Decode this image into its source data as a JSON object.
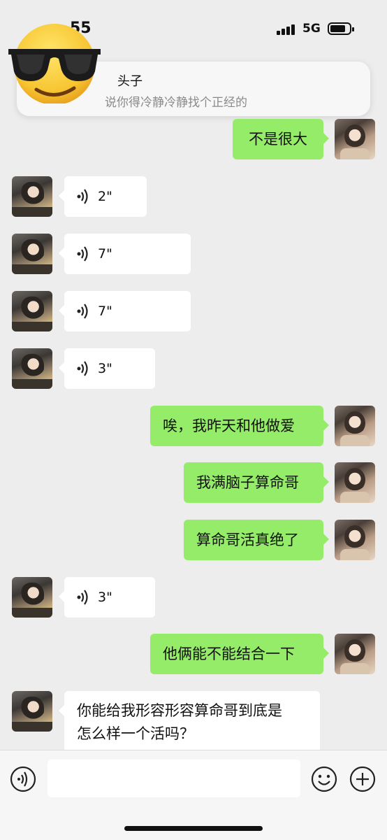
{
  "status_bar": {
    "time": "55",
    "network": "5G",
    "battery_level": 0.8
  },
  "notification": {
    "sender": "头子",
    "preview": "说你得冷静冷静找个正经的"
  },
  "messages": [
    {
      "side": "out",
      "type": "text",
      "text": "不是很大"
    },
    {
      "side": "in",
      "type": "voice",
      "duration": "2\""
    },
    {
      "side": "in",
      "type": "voice",
      "duration": "7\""
    },
    {
      "side": "in",
      "type": "voice",
      "duration": "7\""
    },
    {
      "side": "in",
      "type": "voice",
      "duration": "3\""
    },
    {
      "side": "out",
      "type": "text",
      "text": "唉，我昨天和他做爱"
    },
    {
      "side": "out",
      "type": "text",
      "text": "我满脑子算命哥"
    },
    {
      "side": "out",
      "type": "text",
      "text": "算命哥活真绝了"
    },
    {
      "side": "in",
      "type": "voice",
      "duration": "3\""
    },
    {
      "side": "out",
      "type": "text",
      "text": "他俩能不能结合一下"
    },
    {
      "side": "in",
      "type": "text",
      "lines": [
        "你能给我形容形容算命哥到底是",
        "怎么样一个活吗？"
      ]
    }
  ],
  "input_bar": {
    "voice_icon": "voice-mode-icon",
    "emoji_icon": "emoji-icon",
    "plus_icon": "plus-icon"
  },
  "colors": {
    "background": "#ededed",
    "outgoing_bubble": "#95ec69",
    "incoming_bubble": "#ffffff"
  },
  "overlay": {
    "emoji": "sunglasses-emoji"
  }
}
